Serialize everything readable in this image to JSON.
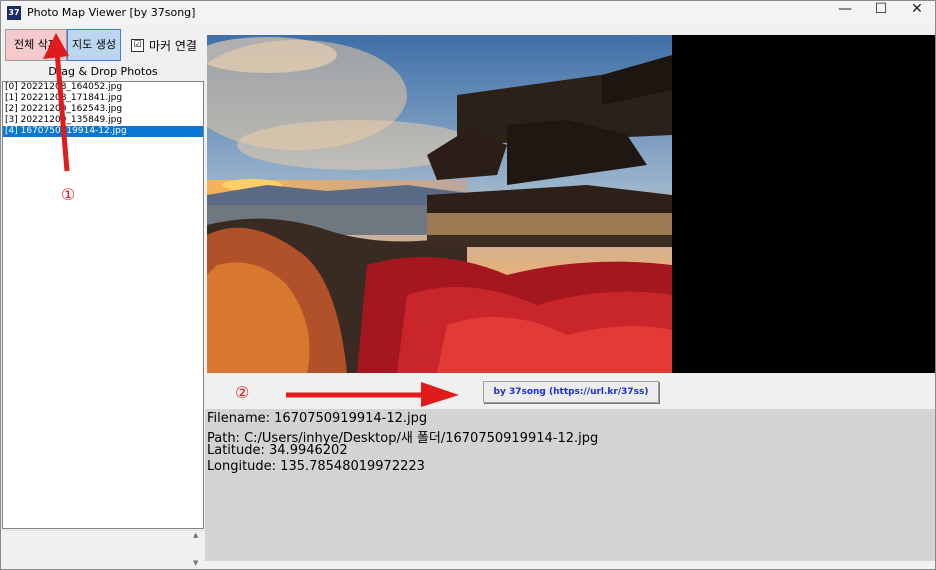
{
  "window": {
    "title": "Photo Map Viewer [by 37song]",
    "icon_text": "37",
    "minimize": "—",
    "maximize": "☐",
    "close": "✕"
  },
  "toolbar": {
    "delete_all_label": "전체 삭제",
    "generate_map_label": "지도 생성",
    "marker_connect_label": "마커 연결",
    "marker_connect_checked": "☑"
  },
  "drop_label": "Drag & Drop Photos",
  "files": [
    "[0]  20221208_164052.jpg",
    "[1]  20221208_171841.jpg",
    "[2]  20221209_162543.jpg",
    "[3]  20221209_135849.jpg",
    "[4]  1670750919914-12.jpg"
  ],
  "link_button_label": "by 37song (https://url.kr/37ss)",
  "info": {
    "filename": "Filename: 1670750919914-12.jpg",
    "path": "Path: C:/Users/inhye/Desktop/새 폴더/1670750919914-12.jpg",
    "latitude": "Latitude: 34.9946202",
    "longitude": "Longitude: 135.78548019972223"
  },
  "annotations": {
    "marker1": "①",
    "marker2": "②"
  },
  "colors": {
    "selected": "#0a78d7",
    "arrow": "#e01b1b",
    "link": "#1a2fd6"
  }
}
